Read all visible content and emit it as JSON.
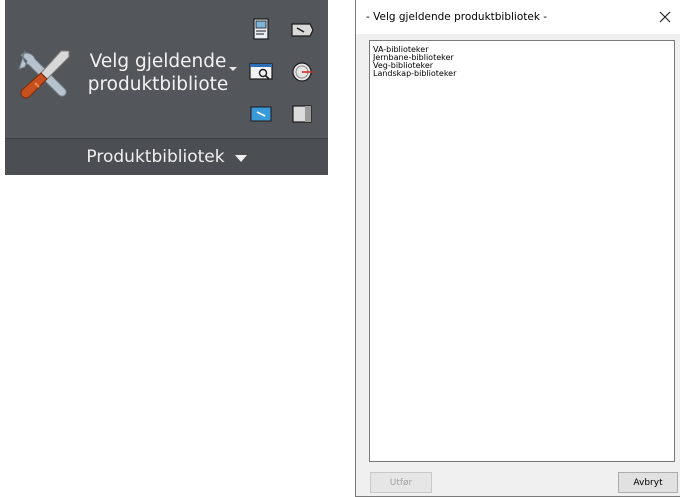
{
  "ribbon": {
    "big_button_label_line1": "Velg gjeldende",
    "big_button_label_line2": "produktbibliote",
    "panel_title": "Produktbibliotek",
    "big_button_icon": "wrench-screwdriver-icon",
    "small_icons": [
      "document-icon",
      "tag-icon",
      "search-window-icon",
      "gauge-icon",
      "blue-tag-icon",
      "panel-icon"
    ]
  },
  "dialog": {
    "title": "- Velg gjeldende produktbibliotek -",
    "close_icon": "close-icon",
    "items": [
      "VA-biblioteker",
      "Jernbane-biblioteker",
      "Veg-biblioteker",
      "Landskap-biblioteker"
    ],
    "run_label": "Utfør",
    "cancel_label": "Avbryt"
  },
  "colors": {
    "ribbon_bg": "#53565b",
    "ribbon_footer": "#4b4e53",
    "dialog_bg": "#f0f0f0"
  }
}
